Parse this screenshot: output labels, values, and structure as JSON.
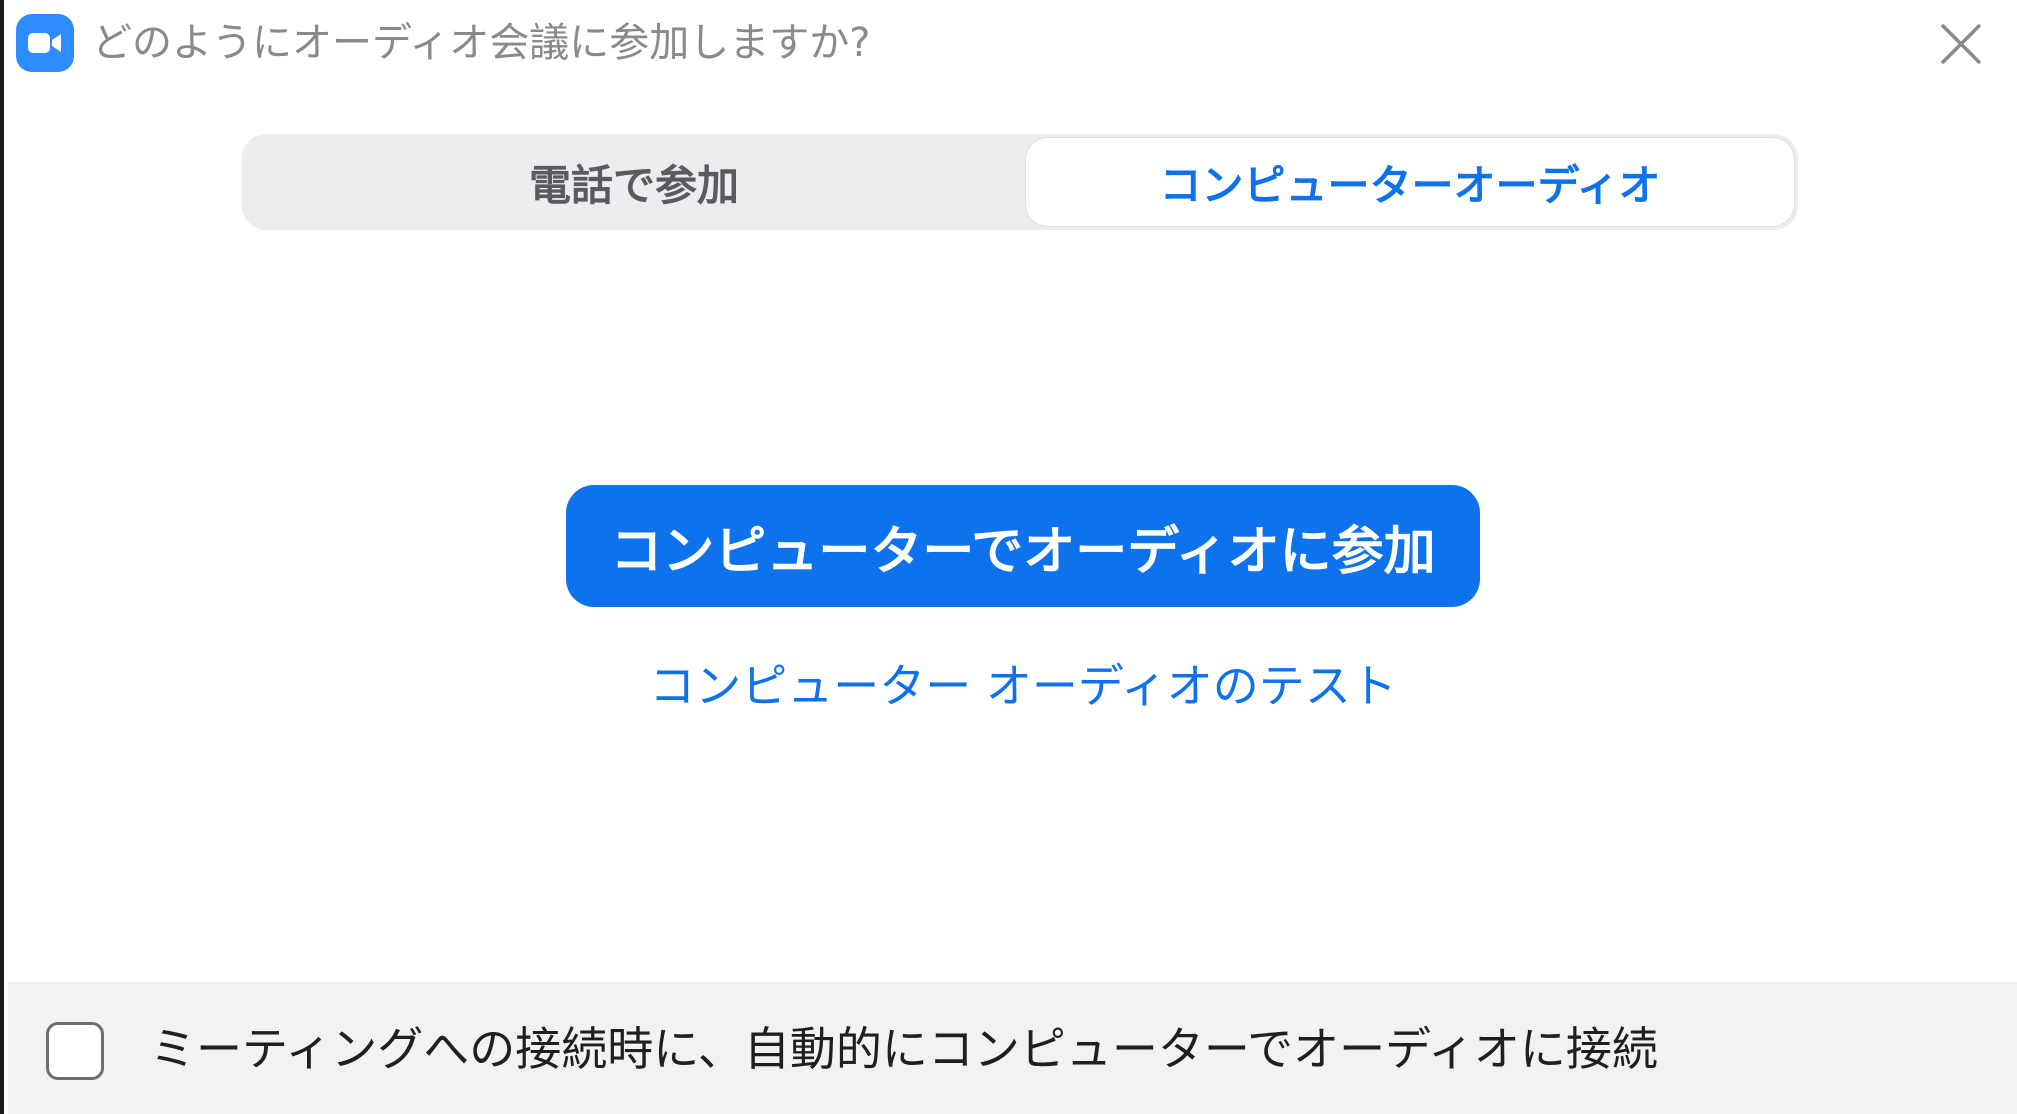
{
  "window": {
    "title": "どのようにオーディオ会議に参加しますか?",
    "app_icon": "video-camera-icon",
    "close_icon": "close-icon"
  },
  "tabs": [
    {
      "label": "電話で参加",
      "selected": false
    },
    {
      "label": "コンピューターオーディオ",
      "selected": true
    }
  ],
  "main": {
    "join_button_label": "コンピューターでオーディオに参加",
    "test_link_label": "コンピューター オーディオのテスト"
  },
  "footer": {
    "auto_connect_label": "ミーティングへの接続時に、自動的にコンピューターでオーディオに接続",
    "auto_connect_checked": false
  },
  "colors": {
    "accent": "#0e72ed",
    "app_icon": "#2d8cff",
    "segment_bg": "#ededf0",
    "footer_bg": "#f2f2f2"
  }
}
